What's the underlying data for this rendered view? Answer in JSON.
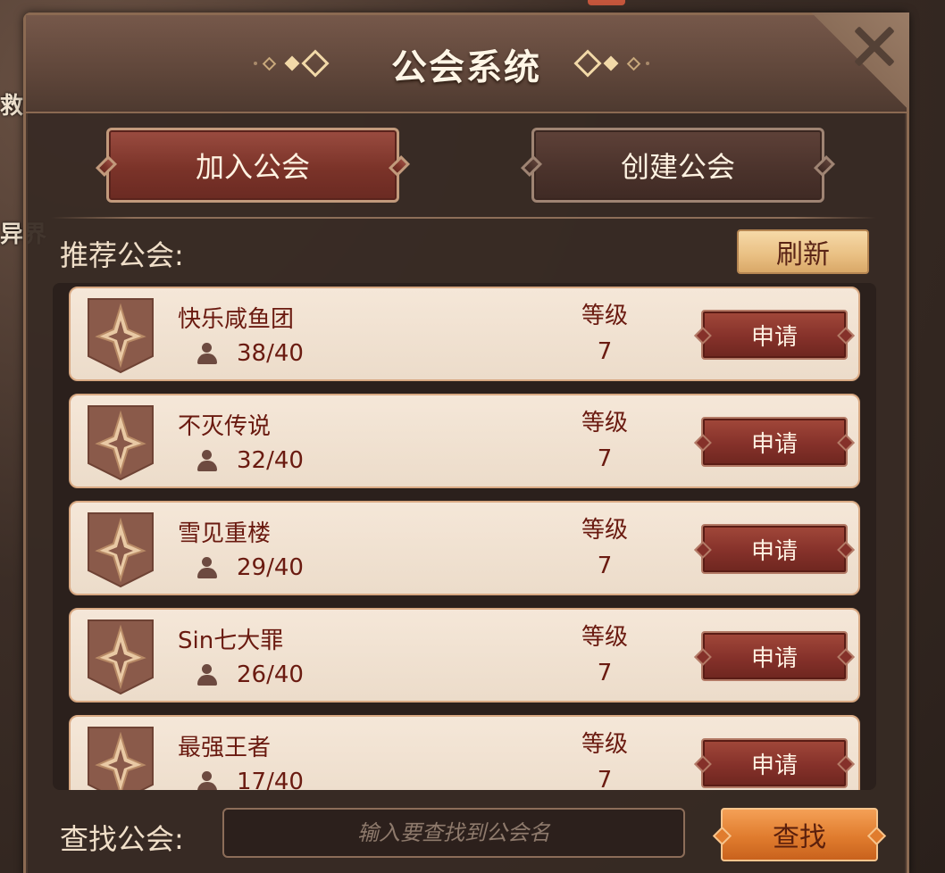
{
  "background": {
    "left_text_1": "救",
    "left_text_2": "异界"
  },
  "window": {
    "title": "公会系统",
    "close_icon": "close-x-icon"
  },
  "actions": {
    "join_label": "加入公会",
    "create_label": "创建公会"
  },
  "recommended": {
    "label": "推荐公会:",
    "refresh_label": "刷新",
    "level_label": "等级",
    "apply_label": "申请",
    "member_icon": "person-icon",
    "emblem_icon": "guild-emblem-icon",
    "guilds": [
      {
        "name": "快乐咸鱼团",
        "members": "38/40",
        "level": "7"
      },
      {
        "name": "不灭传说",
        "members": "32/40",
        "level": "7"
      },
      {
        "name": "雪见重楼",
        "members": "29/40",
        "level": "7"
      },
      {
        "name": "Sin七大罪",
        "members": "26/40",
        "level": "7"
      },
      {
        "name": "最强王者",
        "members": "17/40",
        "level": "7"
      }
    ]
  },
  "search": {
    "label": "查找公会:",
    "placeholder": "输入要查找到公会名",
    "value": "",
    "button_label": "查找"
  },
  "colors": {
    "accent_red": "#85312a",
    "accent_orange": "#e07c2e",
    "row_bg": "#f5e7d8",
    "text_dark_red": "#6a1a10"
  }
}
